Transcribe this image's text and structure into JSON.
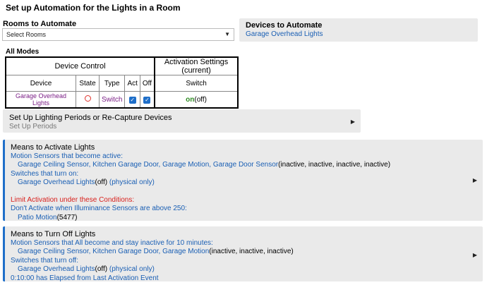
{
  "title": "Set up Automation for the Lights in a Room",
  "rooms": {
    "label": "Rooms to Automate",
    "placeholder": "Select Rooms"
  },
  "devices_card": {
    "heading": "Devices to Automate",
    "value": "Garage Overhead Lights"
  },
  "modes_label": "All Modes",
  "table": {
    "group1": "Device Control",
    "group2": "Activation Settings (current)",
    "headers": [
      "Device",
      "State",
      "Type",
      "Act",
      "Off",
      "Switch"
    ],
    "row": {
      "device": "Garage Overhead Lights",
      "type": "Switch",
      "switch_on": "on",
      "switch_paren": "(off)",
      "act_checked": true,
      "off_checked": true
    }
  },
  "periods": {
    "heading": "Set Up Lighting Periods or Re-Capture Devices",
    "sub": "Set Up Periods"
  },
  "activate": {
    "heading": "Means to Activate Lights",
    "motion_label": "Motion Sensors that become active:",
    "motion_devices": "Garage Ceiling Sensor, Kitchen Garage Door, Garage Motion, Garage Door Sensor",
    "motion_states": "(inactive, inactive, inactive, inactive)",
    "switch_label": "Switches that turn on:",
    "switch_device": "Garage Overhead Lights",
    "switch_state": "(off)",
    "switch_note": " (physical only)",
    "limit_label": "Limit Activation under these Conditions:",
    "illum_label": "Don't Activate when Illuminance Sensors are above 250:",
    "illum_device": "Patio Motion",
    "illum_value": "(5477)"
  },
  "turnoff": {
    "heading": "Means to Turn Off Lights",
    "motion_label": "Motion Sensors that All become and stay inactive for 10 minutes:",
    "motion_devices": "Garage Ceiling Sensor, Kitchen Garage Door, Garage Motion",
    "motion_states": "(inactive, inactive, inactive)",
    "switch_label": "Switches that turn off:",
    "switch_device": "Garage Overhead Lights",
    "switch_state": "(off)",
    "switch_note": " (physical only)",
    "elapsed": "0:10:00 has Elapsed from Last Activation Event"
  }
}
